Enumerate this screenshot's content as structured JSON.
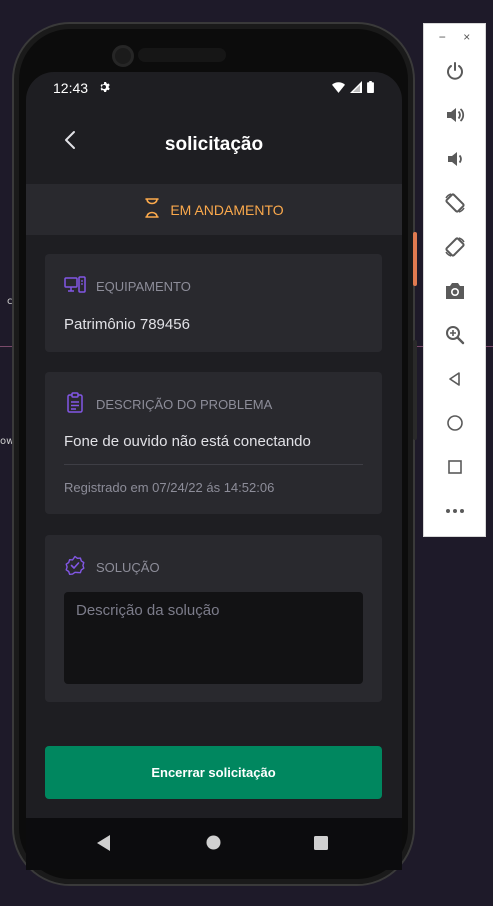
{
  "status_bar": {
    "time": "12:43"
  },
  "header": {
    "title": "solicitação"
  },
  "status": {
    "label": "EM ANDAMENTO"
  },
  "equipment": {
    "heading": "EQUIPAMENTO",
    "value": "Patrimônio 789456"
  },
  "problem": {
    "heading": "DESCRIÇÃO DO PROBLEMA",
    "value": "Fone de ouvido não está conectando",
    "registered": "Registrado em 07/24/22 ás 14:52:06"
  },
  "solution": {
    "heading": "SOLUÇÃO",
    "placeholder": "Descrição da solução"
  },
  "actions": {
    "close_label": "Encerrar solicitação"
  },
  "emulator_panel": {
    "minimize": "−",
    "close": "×"
  },
  "colors": {
    "accent_status": "#fba94c",
    "accent_icon": "#8257e5",
    "primary_button": "#00875f",
    "screen_bg": "#1e1e22",
    "card_bg": "#29292e"
  }
}
